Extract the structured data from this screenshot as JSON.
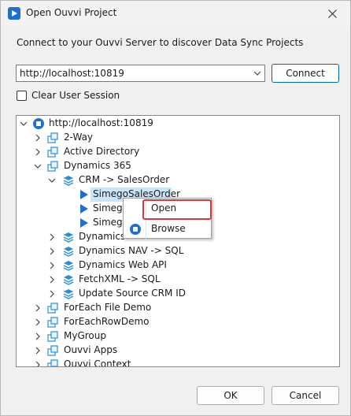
{
  "window": {
    "title": "Open Ouvvi Project"
  },
  "intro_text": "Connect to your Ouvvi Server to discover Data Sync Projects",
  "server": {
    "url": "http://localhost:10819",
    "connect_label": "Connect"
  },
  "clear_session": {
    "label": "Clear User Session",
    "checked": false
  },
  "tree": {
    "root": "http://localhost:10819",
    "rows": [
      {
        "label": "2-Way"
      },
      {
        "label": "Active Directory"
      },
      {
        "label": "Dynamics 365"
      },
      {
        "label": "CRM -> SalesOrder"
      },
      {
        "label": "SimegoSalesOrder"
      },
      {
        "label": "Simego"
      },
      {
        "label": "Simego"
      },
      {
        "label": "Dynamics"
      },
      {
        "label": "Dynamics NAV -> SQL"
      },
      {
        "label": "Dynamics Web API"
      },
      {
        "label": "FetchXML -> SQL"
      },
      {
        "label": "Update Source CRM ID"
      },
      {
        "label": "ForEach File Demo"
      },
      {
        "label": "ForEachRowDemo"
      },
      {
        "label": "MyGroup"
      },
      {
        "label": "Ouvvi Apps"
      },
      {
        "label": "Ouvvi Context"
      }
    ]
  },
  "context_menu": {
    "open_label": "Open",
    "browse_label": "Browse"
  },
  "buttons": {
    "ok_label": "OK",
    "cancel_label": "Cancel"
  },
  "colors": {
    "accent": "#0067c0",
    "selection": "#cce4f7",
    "highlight": "#d9363e"
  }
}
